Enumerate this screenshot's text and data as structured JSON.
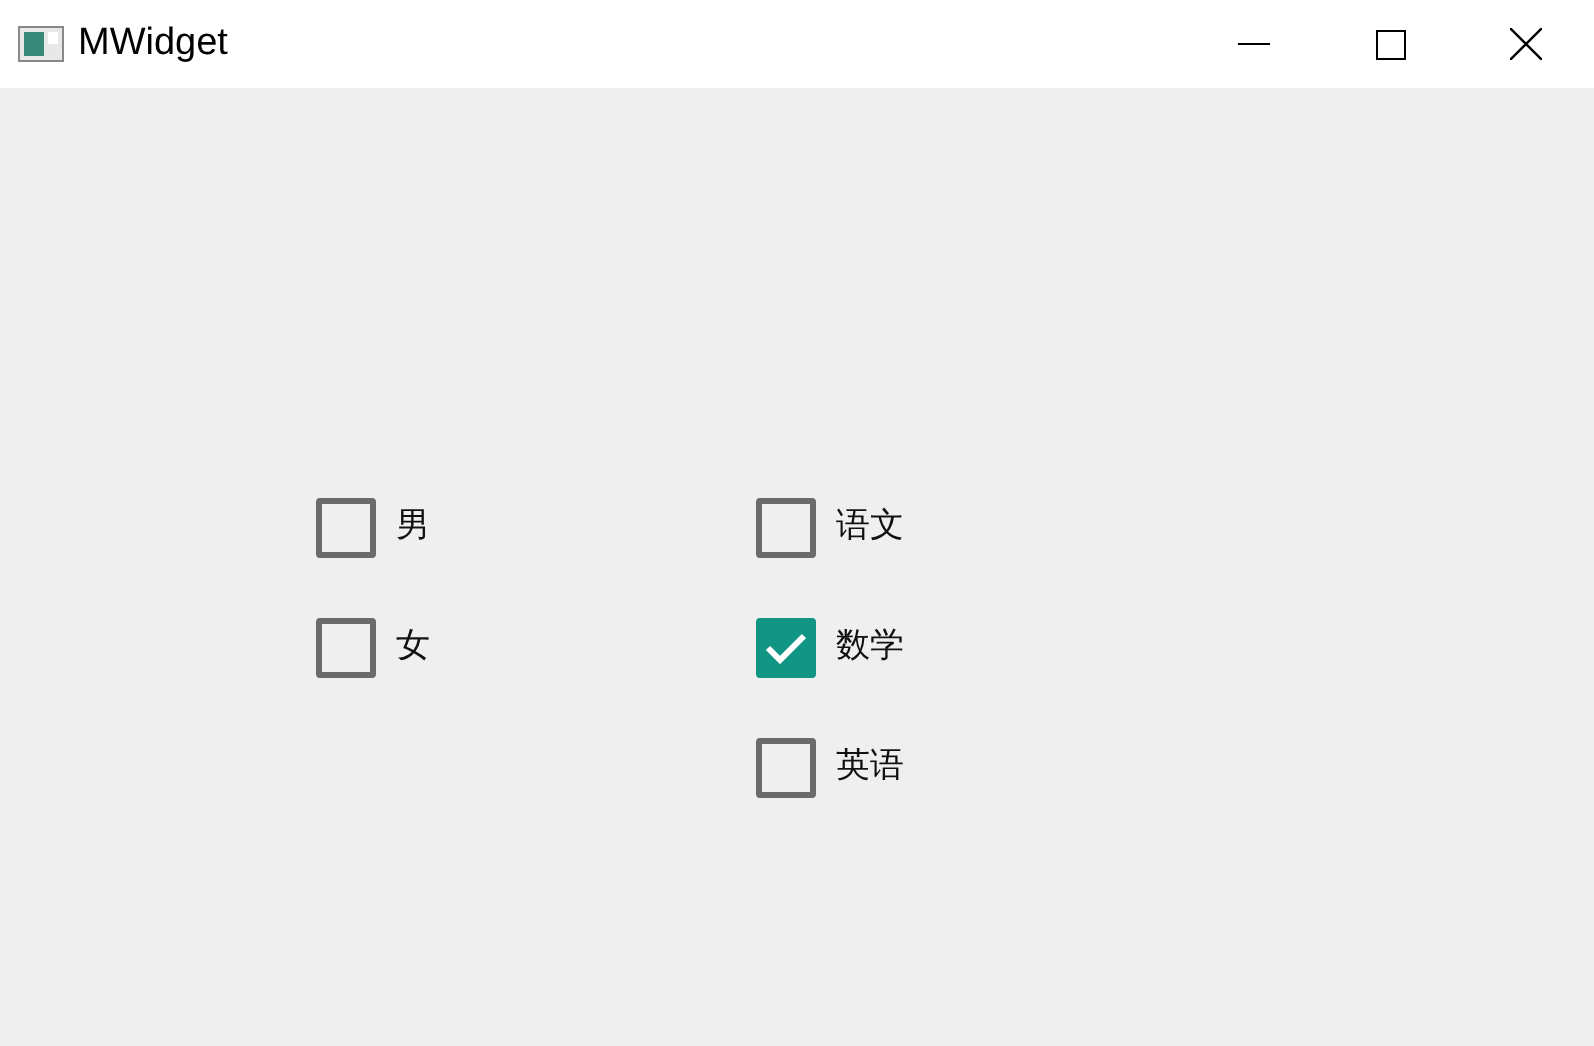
{
  "window": {
    "title": "MWidget"
  },
  "groups": [
    {
      "items": [
        {
          "label": "男",
          "checked": false
        },
        {
          "label": "女",
          "checked": false
        }
      ]
    },
    {
      "items": [
        {
          "label": "语文",
          "checked": false
        },
        {
          "label": "数学",
          "checked": true
        },
        {
          "label": "英语",
          "checked": false
        }
      ]
    }
  ]
}
